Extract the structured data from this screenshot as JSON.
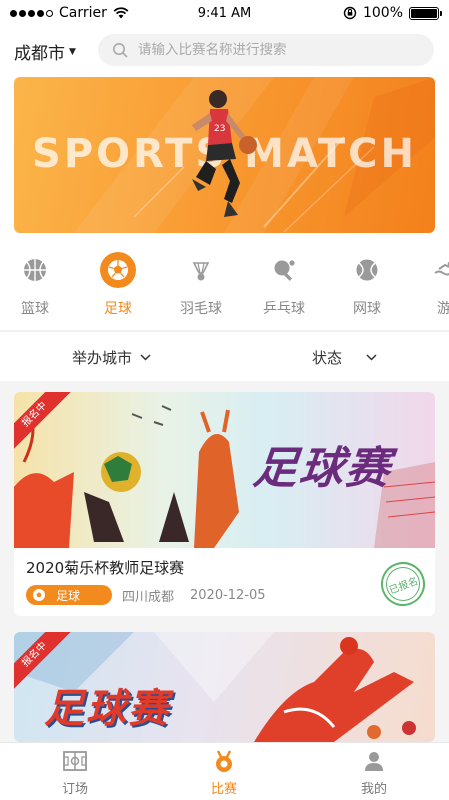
{
  "status_bar": {
    "carrier": "Carrier",
    "time": "9:41 AM",
    "battery": "100%",
    "battery_level": 1.0
  },
  "header": {
    "city": "成都市",
    "search_placeholder": "请输入比赛名称进行搜索"
  },
  "banner": {
    "title": "SPORTS MATCH"
  },
  "categories": [
    {
      "label": "篮球",
      "icon": "basketball-icon",
      "active": false
    },
    {
      "label": "足球",
      "icon": "soccer-ball-icon",
      "active": true
    },
    {
      "label": "羽毛球",
      "icon": "badminton-icon",
      "active": false
    },
    {
      "label": "乒乓球",
      "icon": "table-tennis-icon",
      "active": false
    },
    {
      "label": "网球",
      "icon": "tennis-icon",
      "active": false
    },
    {
      "label": "游",
      "icon": "swimming-icon",
      "active": false
    }
  ],
  "filters": {
    "city_label": "举办城市",
    "status_label": "状态"
  },
  "matches": [
    {
      "ribbon": "报名中",
      "image_text": "足球赛",
      "title": "2020菊乐杯教师足球赛",
      "tag": "足球",
      "location": "四川成都",
      "date": "2020-12-05",
      "stamp": "已报名"
    },
    {
      "ribbon": "报名中",
      "image_text": "足球赛"
    }
  ],
  "tabbar": {
    "items": [
      {
        "label": "订场",
        "icon": "field-icon",
        "active": false
      },
      {
        "label": "比赛",
        "icon": "match-icon",
        "active": true
      },
      {
        "label": "我的",
        "icon": "user-icon",
        "active": false
      }
    ]
  },
  "colors": {
    "accent": "#f28a1e",
    "ribbon": "#e0312f",
    "stamp": "#5bb46a"
  }
}
